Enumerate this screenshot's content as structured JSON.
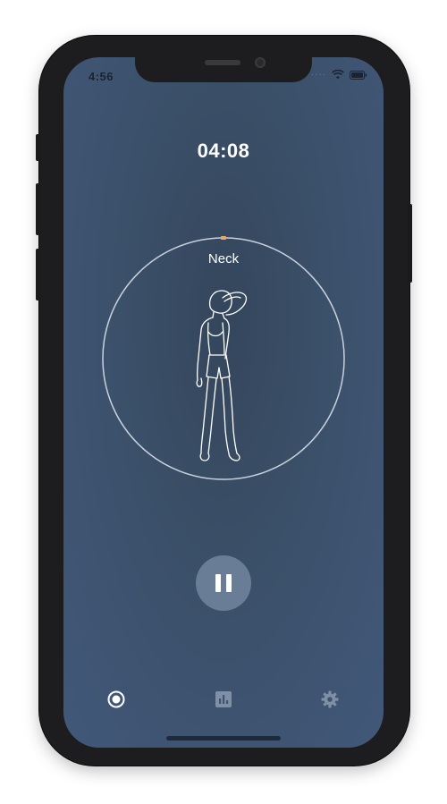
{
  "status_bar": {
    "time": "4:56"
  },
  "workout": {
    "timer": "04:08",
    "exercise": "Neck",
    "progress": 0.0
  },
  "controls": {
    "state": "playing"
  },
  "tab_bar": {
    "tabs": [
      {
        "icon": "record-icon",
        "active": true
      },
      {
        "icon": "stats-icon",
        "active": false
      },
      {
        "icon": "gear-icon",
        "active": false
      }
    ]
  },
  "colors": {
    "background": "#3b5069",
    "accent": "#e8a96a",
    "ring": "#c9d2dc",
    "pause_button": "#6a7d96"
  }
}
